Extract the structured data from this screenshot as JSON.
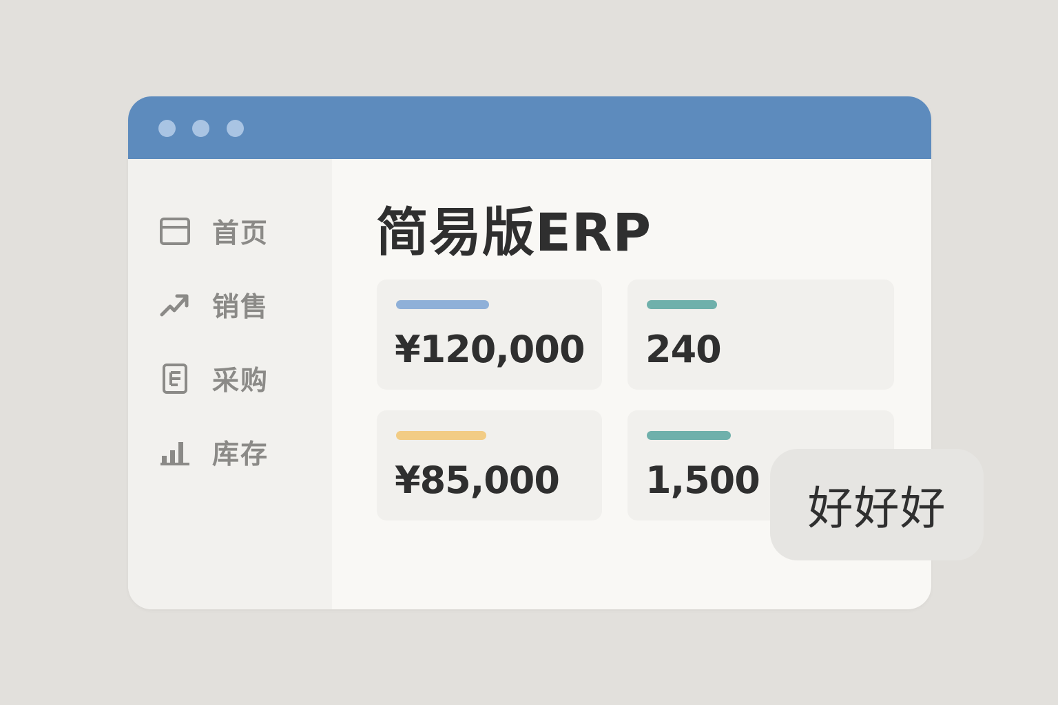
{
  "window": {
    "controls": [
      "dot",
      "dot",
      "dot"
    ]
  },
  "sidebar": {
    "items": [
      {
        "label": "首页",
        "icon": "window-icon"
      },
      {
        "label": "销售",
        "icon": "trend-arrow-icon"
      },
      {
        "label": "采购",
        "icon": "document-icon"
      },
      {
        "label": "库存",
        "icon": "bar-chart-icon"
      }
    ]
  },
  "main": {
    "title": "简易版ERP",
    "cards": [
      {
        "value": "¥120,000",
        "accent": "#8fb0d8"
      },
      {
        "value": "240",
        "accent": "#6fb0ab"
      },
      {
        "value": "¥85,000",
        "accent": "#f2cc85"
      },
      {
        "value": "1,500",
        "accent": "#6fb0ab"
      }
    ]
  },
  "toast": {
    "text": "好好好"
  },
  "colors": {
    "titlebar": "#5d8bbd",
    "sidebar_bg": "#f2f1ee",
    "content_bg": "#f9f8f5",
    "page_bg": "#e2e0dc"
  }
}
